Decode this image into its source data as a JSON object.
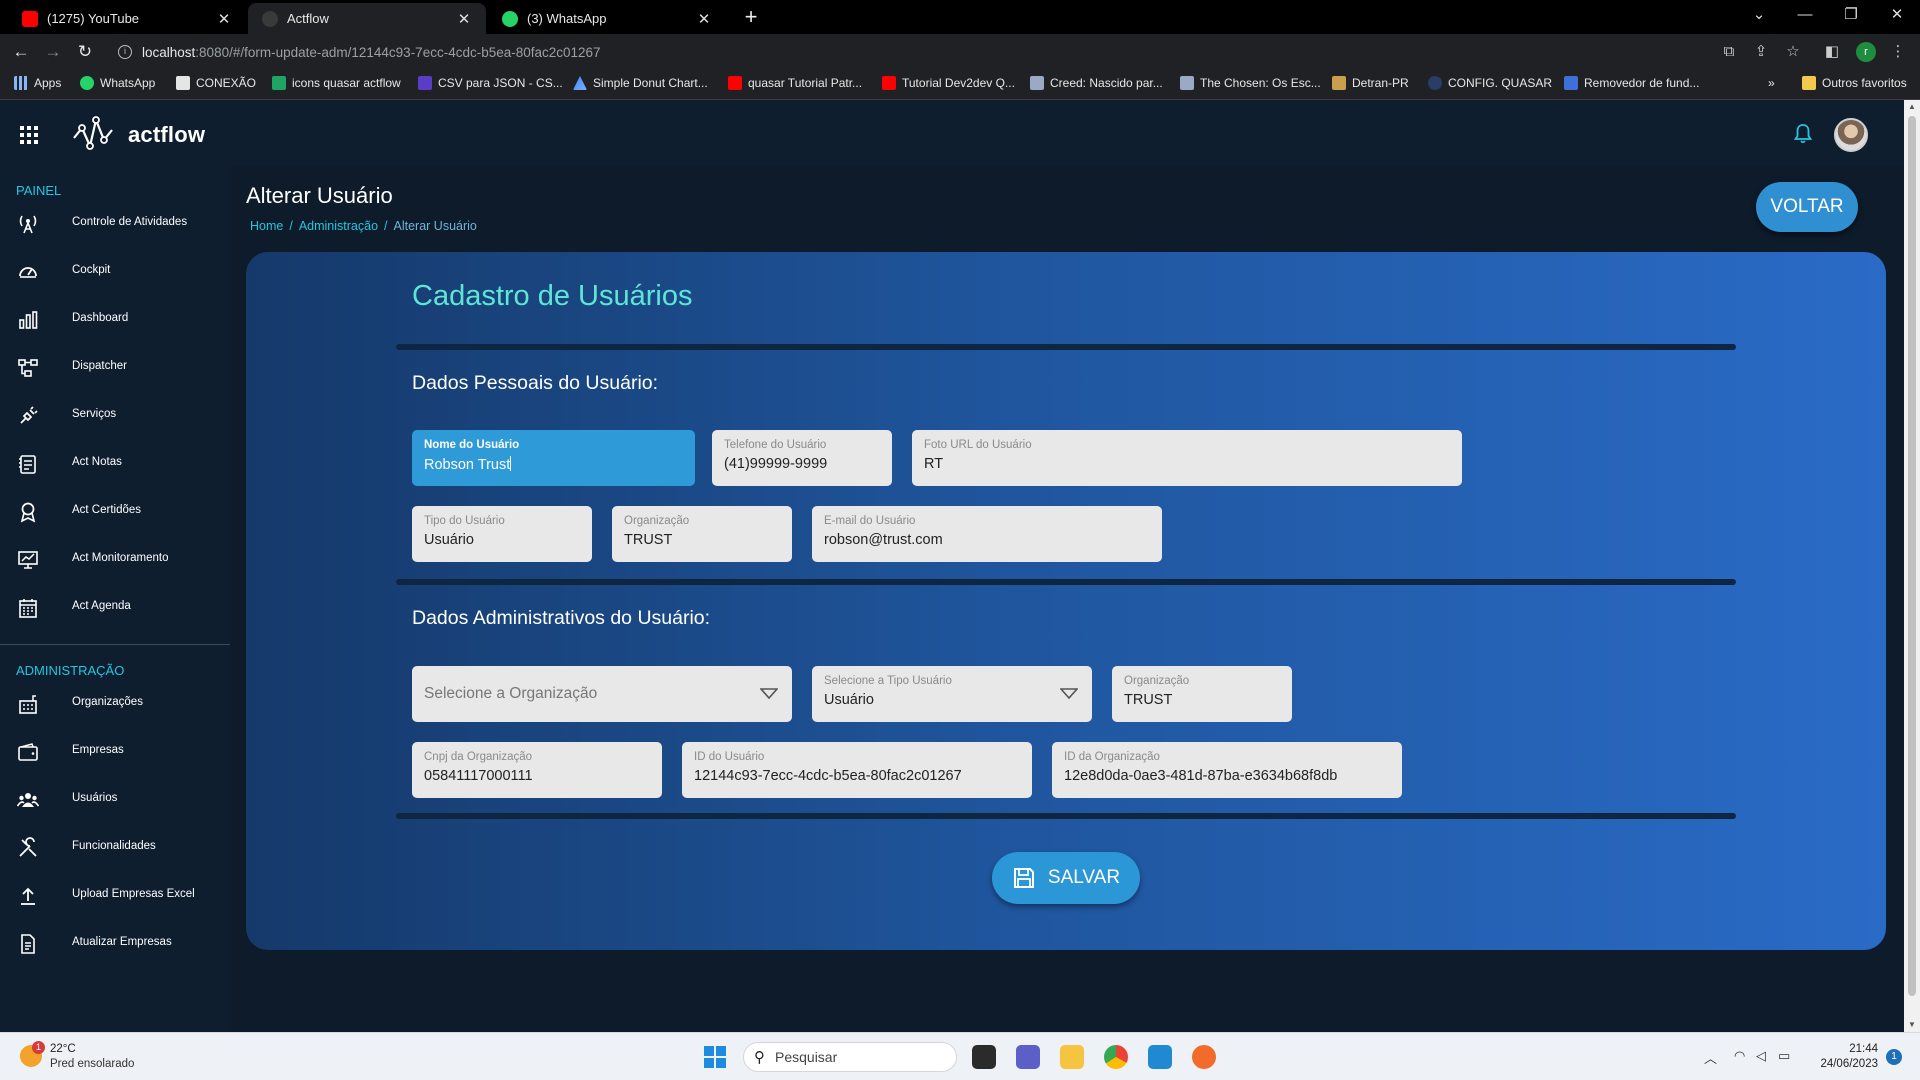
{
  "browser": {
    "tabs": [
      {
        "title": "(1275) YouTube",
        "active": false
      },
      {
        "title": "Actflow",
        "active": true
      },
      {
        "title": "(3) WhatsApp",
        "active": false
      }
    ],
    "url_host": "localhost",
    "url_path": ":8080/#/form-update-adm/12144c93-7ecc-4cdc-b5ea-80fac2c01267",
    "profile_initial": "r",
    "bookmarks": [
      "Apps",
      "WhatsApp",
      "CONEXÃO",
      "icons quasar actflow",
      "CSV para JSON - CS...",
      "Simple Donut Chart...",
      "quasar Tutorial Patr...",
      "Tutorial Dev2dev Q...",
      "Creed: Nascido par...",
      "The Chosen: Os Esc...",
      "Detran-PR",
      "CONFIG. QUASAR",
      "Removedor de fund..."
    ],
    "bookmarks_more": "»",
    "other_bookmarks": "Outros favoritos"
  },
  "app": {
    "brand": "actflow",
    "sidebar": {
      "painel_title": "PAINEL",
      "painel_items": [
        {
          "label": "Controle de Atividades",
          "icon": "antenna-icon"
        },
        {
          "label": "Cockpit",
          "icon": "gauge-icon"
        },
        {
          "label": "Dashboard",
          "icon": "bar-chart-icon"
        },
        {
          "label": "Dispatcher",
          "icon": "flow-icon"
        },
        {
          "label": "Serviços",
          "icon": "plug-icon"
        },
        {
          "label": "Act Notas",
          "icon": "notes-icon"
        },
        {
          "label": "Act Certidões",
          "icon": "badge-icon"
        },
        {
          "label": "Act Monitoramento",
          "icon": "monitor-chart-icon"
        },
        {
          "label": "Act Agenda",
          "icon": "calendar-icon"
        }
      ],
      "admin_title": "ADMINISTRAÇÃO",
      "admin_items": [
        {
          "label": "Organizações",
          "icon": "organization-icon"
        },
        {
          "label": "Empresas",
          "icon": "wallet-icon"
        },
        {
          "label": "Usuários",
          "icon": "users-icon"
        },
        {
          "label": "Funcionalidades",
          "icon": "tools-icon"
        },
        {
          "label": "Upload Empresas Excel",
          "icon": "upload-icon"
        },
        {
          "label": "Atualizar Empresas",
          "icon": "document-icon"
        }
      ]
    },
    "page": {
      "title": "Alterar Usuário",
      "breadcrumb": [
        "Home",
        "Administração",
        "Alterar Usuário"
      ],
      "breadcrumb_sep": "/",
      "back_label": "VOLTAR"
    },
    "form": {
      "title": "Cadastro de Usuários",
      "personal_heading": "Dados Pessoais do Usuário:",
      "admin_heading": "Dados Administrativos do Usuário:",
      "nome": {
        "label": "Nome do Usuário",
        "value": "Robson Trust"
      },
      "telefone": {
        "label": "Telefone do Usuário",
        "value": "(41)99999-9999"
      },
      "foto": {
        "label": "Foto URL do Usuário",
        "value": "RT"
      },
      "tipo": {
        "label": "Tipo do Usuário",
        "value": "Usuário"
      },
      "organizacao": {
        "label": "Organização",
        "value": "TRUST"
      },
      "email": {
        "label": "E-mail do Usuário",
        "value": "robson@trust.com"
      },
      "select_org": {
        "placeholder": "Selecione a Organização"
      },
      "select_tipo": {
        "label": "Selecione a Tipo Usuário",
        "value": "Usuário"
      },
      "organizacao2": {
        "label": "Organização",
        "value": "TRUST"
      },
      "cnpj": {
        "label": "Cnpj da Organização",
        "value": "05841117000111"
      },
      "id_usuario": {
        "label": "ID do Usuário",
        "value": "12144c93-7ecc-4cdc-b5ea-80fac2c01267"
      },
      "id_org": {
        "label": "ID da Organização",
        "value": "12e8d0da-0ae3-481d-87ba-e3634b68f8db"
      },
      "save_label": "SALVAR"
    }
  },
  "taskbar": {
    "weather_temp": "22°C",
    "weather_desc": "Pred ensolarado",
    "weather_badge": "1",
    "search_placeholder": "Pesquisar",
    "time": "21:44",
    "date": "24/06/2023",
    "notifications": "1"
  },
  "colors": {
    "accent": "#25c6e0",
    "card_title": "#5fe5d6",
    "button": "#2f8fd0",
    "focused_field": "#2f9ad8"
  }
}
